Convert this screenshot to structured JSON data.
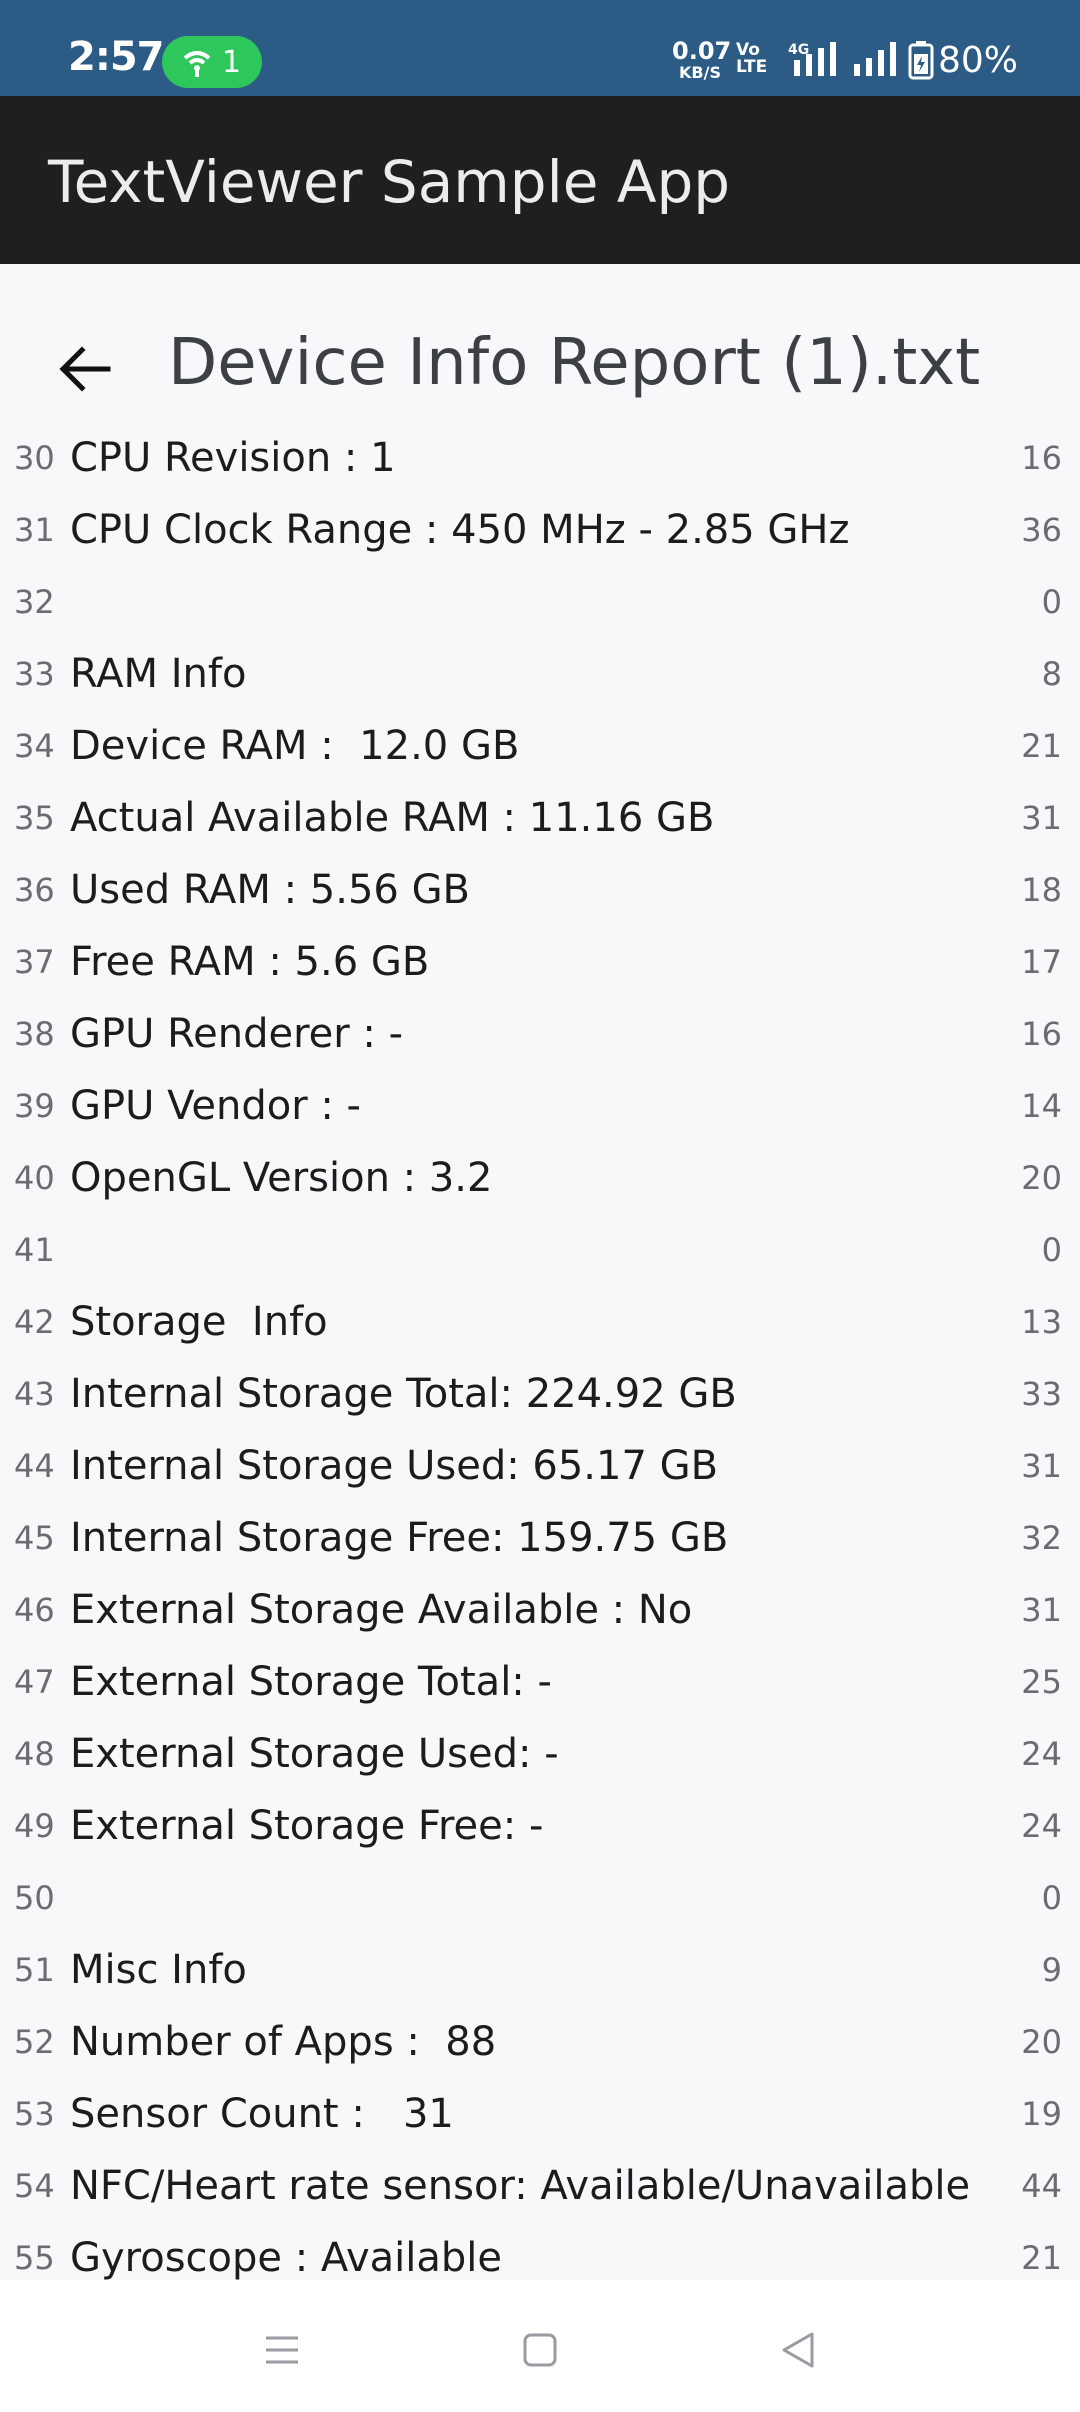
{
  "status_bar": {
    "time": "2:57",
    "hotspot_count": "1",
    "net_speed_value": "0.07",
    "net_speed_unit": "KB/S",
    "volte_top": "Vo",
    "volte_bottom": "LTE",
    "network_type": "4G",
    "battery": "80%",
    "icons": [
      "hotspot-icon",
      "signal-icon",
      "signal-icon",
      "battery-icon"
    ]
  },
  "app_bar": {
    "title": "TextViewer Sample App"
  },
  "header": {
    "back_icon": "arrow-left-icon",
    "file_name": "Device Info Report (1).txt"
  },
  "lines": [
    {
      "n": "30",
      "text": "CPU Revision : 1",
      "count": "16"
    },
    {
      "n": "31",
      "text": "CPU Clock Range : 450 MHz - 2.85 GHz",
      "count": "36"
    },
    {
      "n": "32",
      "text": "",
      "count": "0"
    },
    {
      "n": "33",
      "text": "RAM Info",
      "count": "8"
    },
    {
      "n": "34",
      "text": "Device RAM :  12.0 GB",
      "count": "21"
    },
    {
      "n": "35",
      "text": "Actual Available RAM : 11.16 GB",
      "count": "31"
    },
    {
      "n": "36",
      "text": "Used RAM : 5.56 GB",
      "count": "18"
    },
    {
      "n": "37",
      "text": "Free RAM : 5.6 GB",
      "count": "17"
    },
    {
      "n": "38",
      "text": "GPU Renderer : -",
      "count": "16"
    },
    {
      "n": "39",
      "text": "GPU Vendor : -",
      "count": "14"
    },
    {
      "n": "40",
      "text": "OpenGL Version : 3.2",
      "count": "20"
    },
    {
      "n": "41",
      "text": "",
      "count": "0"
    },
    {
      "n": "42",
      "text": "Storage  Info",
      "count": "13"
    },
    {
      "n": "43",
      "text": "Internal Storage Total: 224.92 GB",
      "count": "33"
    },
    {
      "n": "44",
      "text": "Internal Storage Used: 65.17 GB",
      "count": "31"
    },
    {
      "n": "45",
      "text": "Internal Storage Free: 159.75 GB",
      "count": "32"
    },
    {
      "n": "46",
      "text": "External Storage Available : No",
      "count": "31"
    },
    {
      "n": "47",
      "text": "External Storage Total: -",
      "count": "25"
    },
    {
      "n": "48",
      "text": "External Storage Used: -",
      "count": "24"
    },
    {
      "n": "49",
      "text": "External Storage Free: -",
      "count": "24"
    },
    {
      "n": "50",
      "text": "",
      "count": "0"
    },
    {
      "n": "51",
      "text": "Misc Info",
      "count": "9"
    },
    {
      "n": "52",
      "text": "Number of Apps :  88",
      "count": "20"
    },
    {
      "n": "53",
      "text": "Sensor Count :   31",
      "count": "19"
    },
    {
      "n": "54",
      "text": "NFC/Heart rate sensor: Available/Unavailable",
      "count": "44"
    },
    {
      "n": "55",
      "text": "Gyroscope : Available",
      "count": "21"
    }
  ],
  "nav_bar": {
    "icons": [
      "menu-icon",
      "home-icon",
      "back-triangle-icon"
    ]
  }
}
